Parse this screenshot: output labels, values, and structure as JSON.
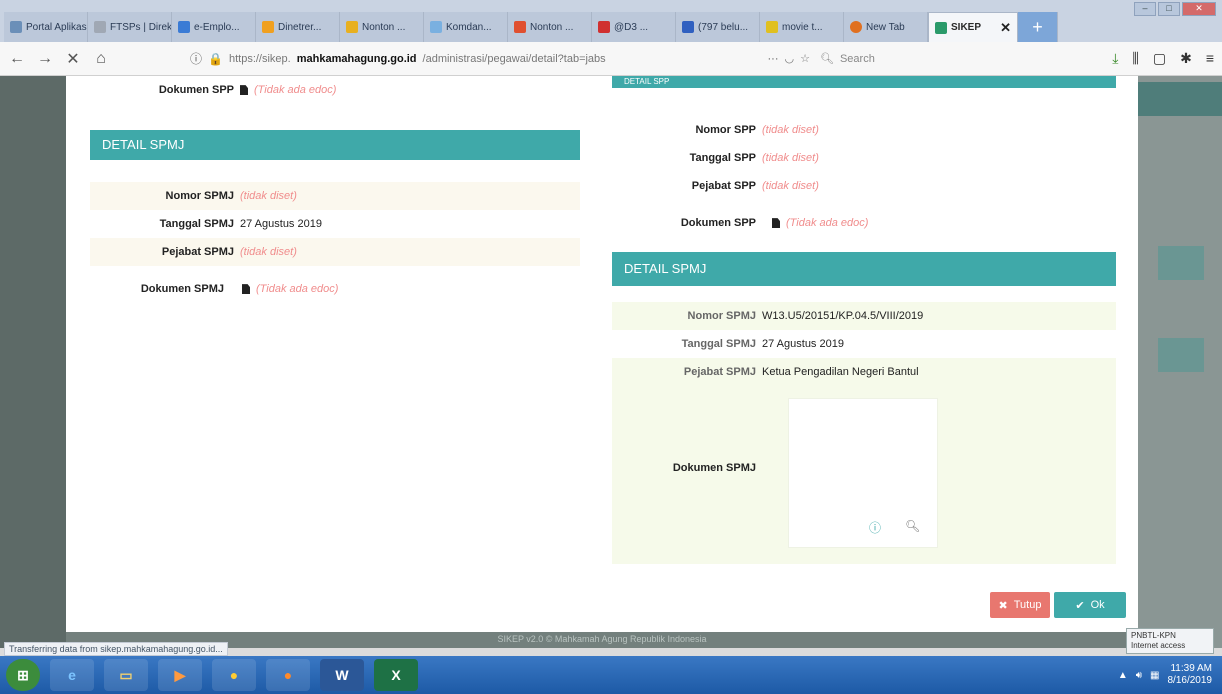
{
  "browser": {
    "tabs": [
      {
        "label": "Portal Aplikasi",
        "color": "#6b8fb8"
      },
      {
        "label": "FTSPs | Direk...",
        "color": "#a0a8b4"
      },
      {
        "label": "e-Emplo...",
        "color": "#3a7bd5"
      },
      {
        "label": "Dinetrer...",
        "color": "#f0a020"
      },
      {
        "label": "Nonton ...",
        "color": "#e8b020"
      },
      {
        "label": "Komdan...",
        "color": "#7ab0e0"
      },
      {
        "label": "Nonton ...",
        "color": "#e05030"
      },
      {
        "label": "@D3 ...",
        "color": "#d03030"
      },
      {
        "label": "(797 belu...",
        "color": "#3060c0"
      },
      {
        "label": "movie t...",
        "color": "#e0c020"
      },
      {
        "label": "New Tab",
        "color": "#e07020"
      },
      {
        "label": "SIKEP",
        "color": "#2a9a6a"
      }
    ],
    "new_tab": "+",
    "url_prefix": "https://sikep.",
    "url_domain": "mahkamahagung.go.id",
    "url_path": "/administrasi/pegawai/detail?tab=jabs",
    "url_dots": "···",
    "search_placeholder": "Search",
    "status_text": "Transferring data from sikep.mahkamahagung.go.id..."
  },
  "left": {
    "top_row": {
      "label": "Dokumen SPP",
      "value": "(Tidak ada edoc)"
    },
    "spmj": {
      "title": "DETAIL SPMJ",
      "rows": [
        {
          "label": "Nomor SPMJ",
          "value": "(tidak diset)",
          "missing": true
        },
        {
          "label": "Tanggal SPMJ",
          "value": "27 Agustus 2019",
          "missing": false
        },
        {
          "label": "Pejabat SPMJ",
          "value": "(tidak diset)",
          "missing": true
        }
      ],
      "doc": {
        "label": "Dokumen SPMJ",
        "value": "(Tidak ada edoc)"
      }
    }
  },
  "right": {
    "top_header": "DETAIL SPP",
    "spp": {
      "rows": [
        {
          "label": "Nomor SPP",
          "value": "(tidak diset)"
        },
        {
          "label": "Tanggal SPP",
          "value": "(tidak diset)"
        },
        {
          "label": "Pejabat SPP",
          "value": "(tidak diset)"
        }
      ],
      "doc": {
        "label": "Dokumen SPP",
        "value": "(Tidak ada edoc)"
      }
    },
    "spmj": {
      "title": "DETAIL SPMJ",
      "rows": [
        {
          "label": "Nomor SPMJ",
          "value": "W13.U5/20151/KP.04.5/VIII/2019"
        },
        {
          "label": "Tanggal SPMJ",
          "value": "27 Agustus 2019"
        },
        {
          "label": "Pejabat SPMJ",
          "value": "Ketua Pengadilan Negeri Bantul"
        }
      ],
      "doc_label": "Dokumen SPMJ"
    }
  },
  "buttons": {
    "tutup": "Tutup",
    "ok": "Ok"
  },
  "footer": "SIKEP v2.0 © Mahkamah Agung Republik Indonesia",
  "taskbar": {
    "time": "11:39 AM",
    "date": "8/16/2019",
    "tooltip_line1": "PNBTL-KPN",
    "tooltip_line2": "Internet access"
  }
}
